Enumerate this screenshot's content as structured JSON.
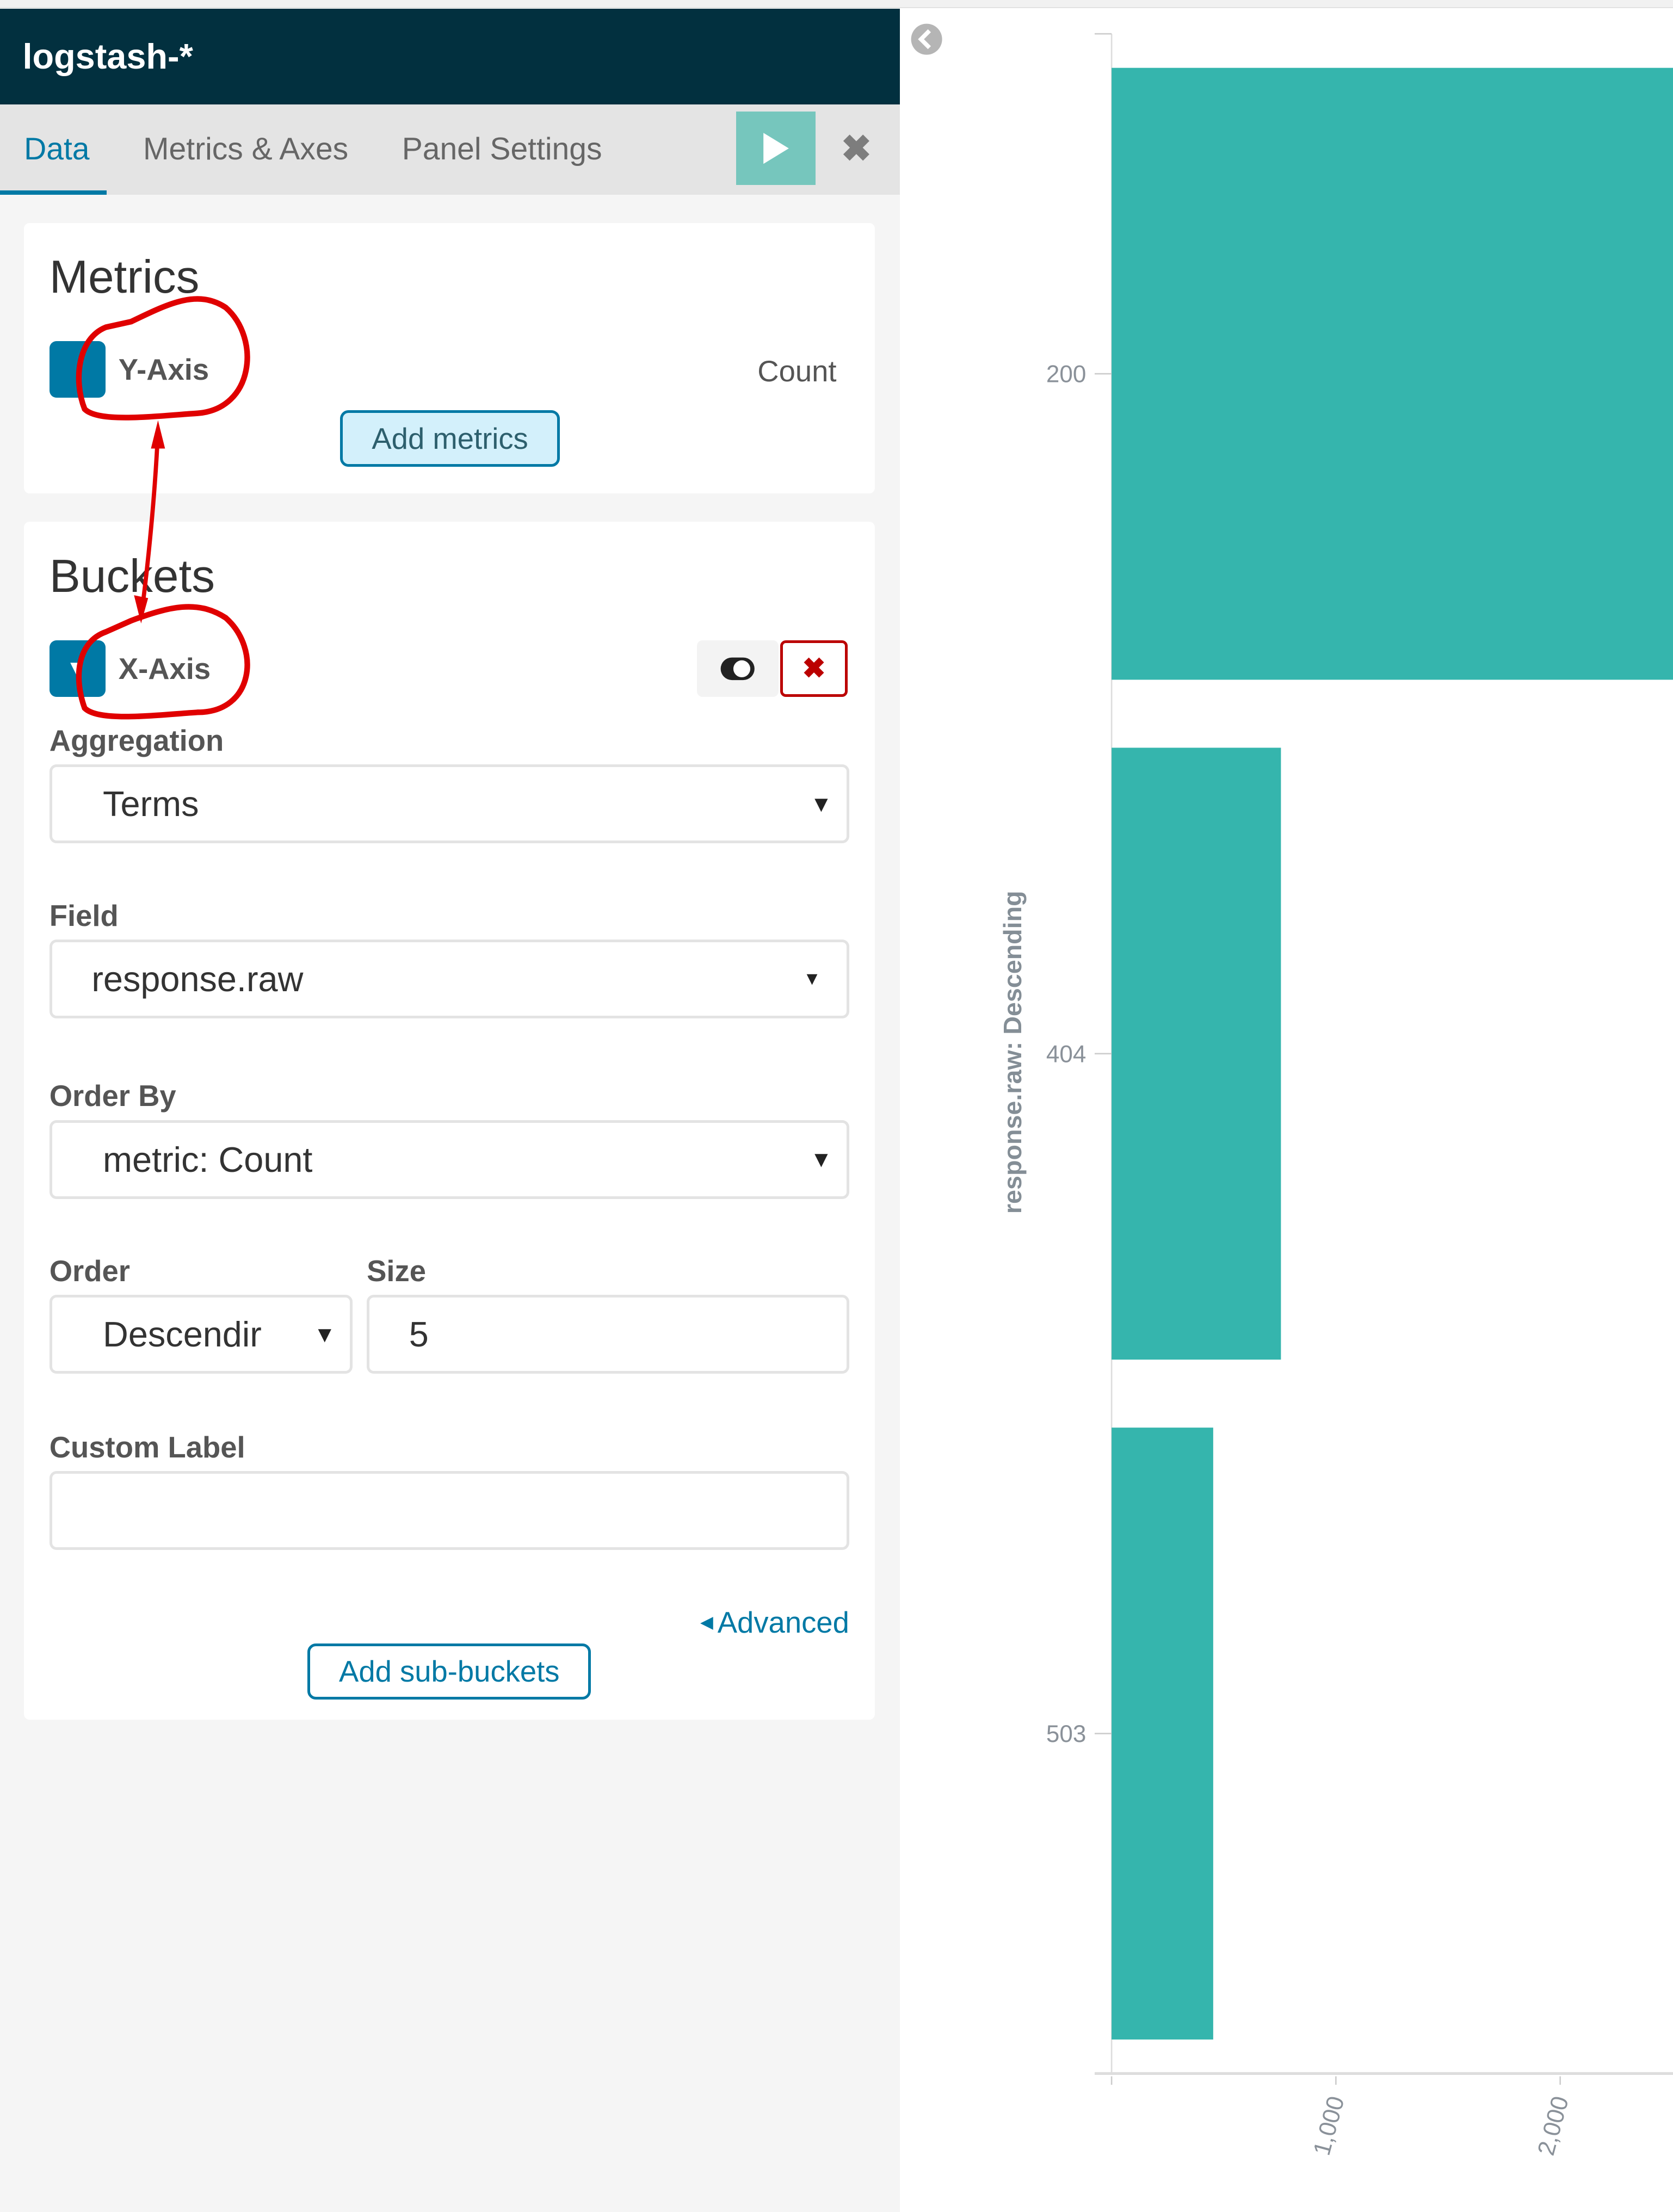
{
  "header": {
    "title": "logstash-*"
  },
  "tabs": [
    {
      "label": "Data",
      "active": true
    },
    {
      "label": "Metrics & Axes",
      "active": false
    },
    {
      "label": "Panel Settings",
      "active": false
    }
  ],
  "toolbar": {
    "apply_icon": "play-icon",
    "close_icon": "close-icon"
  },
  "metrics": {
    "title": "Metrics",
    "item_label": "Y-Axis",
    "item_value": "Count",
    "add_button": "Add metrics"
  },
  "buckets": {
    "title": "Buckets",
    "item_label": "X-Axis",
    "aggregation_label": "Aggregation",
    "aggregation_value": "Terms",
    "field_label": "Field",
    "field_value": "response.raw",
    "order_by_label": "Order By",
    "order_by_value": "metric: Count",
    "order_label": "Order",
    "order_value": "Descendir",
    "size_label": "Size",
    "size_value": "5",
    "custom_label_label": "Custom Label",
    "custom_label_value": "",
    "advanced_link": "Advanced",
    "add_sub_buckets": "Add sub-buckets"
  },
  "colors": {
    "accent": "#0079a5",
    "bar": "#35b5ad",
    "header_bg": "#02303f",
    "annotation": "#e00000",
    "danger": "#bb0000"
  },
  "chart_data": {
    "type": "bar",
    "orientation": "horizontal",
    "title": "",
    "ylabel": "response.raw: Descending",
    "xlabel": "",
    "categories": [
      "200",
      "404",
      "503"
    ],
    "values": [
      2600,
      755,
      453
    ],
    "xlim": [
      0,
      2500
    ],
    "x_ticks": [
      "1,000",
      "2,000"
    ],
    "note": "200 bar extends beyond visible area",
    "grid": false,
    "legend": "none"
  }
}
